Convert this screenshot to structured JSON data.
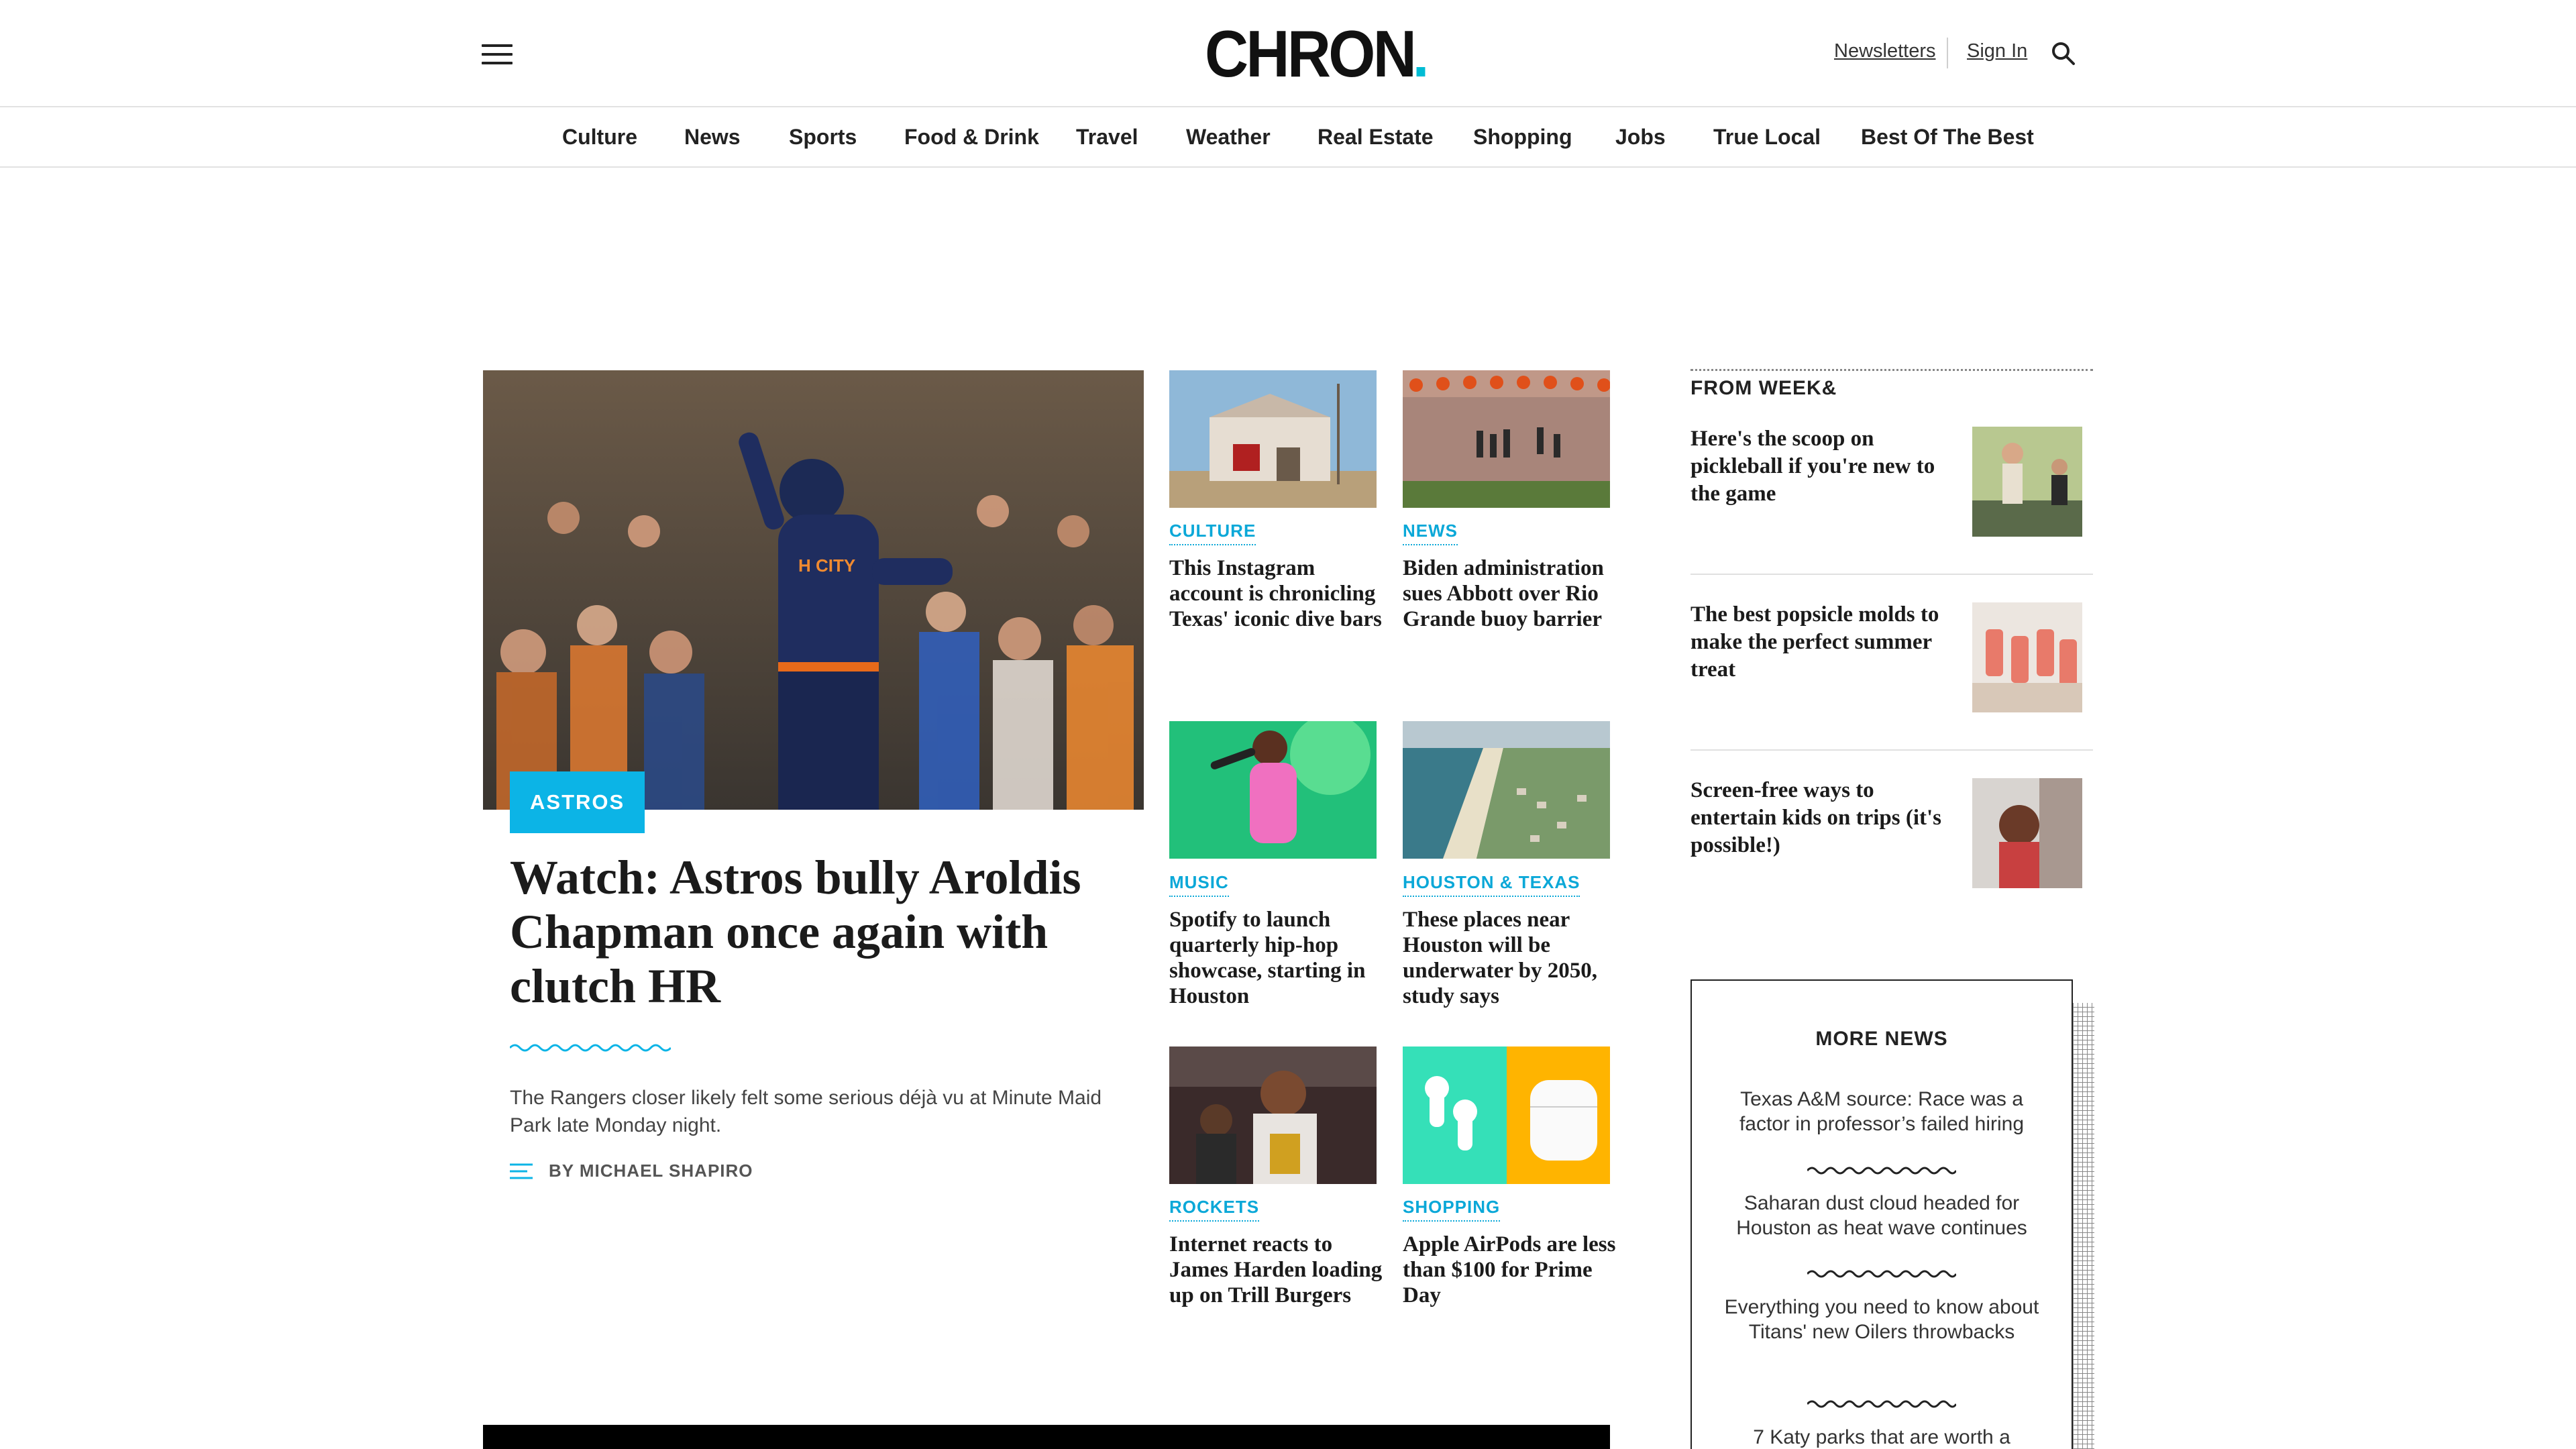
{
  "header": {
    "logo": "CHRON",
    "newsletters_label": "Newsletters",
    "signin_label": "Sign In"
  },
  "nav": {
    "items": [
      "Culture",
      "News",
      "Sports",
      "Food & Drink",
      "Travel",
      "Weather",
      "Real Estate",
      "Shopping",
      "Jobs",
      "True Local",
      "Best Of The Best"
    ]
  },
  "lead": {
    "category": "ASTROS",
    "title": "Watch: Astros bully Aroldis Chapman once again with clutch HR",
    "description": "The Rangers closer likely felt some serious déjà vu at Minute Maid Park late Monday night.",
    "byline": "BY MICHAEL SHAPIRO"
  },
  "grid": [
    {
      "category": "CULTURE",
      "title": "This Instagram account is chronicling Texas' iconic dive bars"
    },
    {
      "category": "NEWS",
      "title": "Biden administration sues Abbott over Rio Grande buoy barrier"
    },
    {
      "category": "MUSIC",
      "title": "Spotify to launch quarterly hip-hop showcase, starting in Houston"
    },
    {
      "category": "HOUSTON & TEXAS",
      "title": "These places near Houston will be underwater by 2050, study says"
    },
    {
      "category": "ROCKETS",
      "title": "Internet reacts to James Harden loading up on Trill Burgers"
    },
    {
      "category": "SHOPPING",
      "title": "Apple AirPods are less than $100 for Prime Day"
    }
  ],
  "rail": {
    "heading": "FROM WEEK&",
    "items": [
      {
        "title": "Here's the scoop on pickleball if you're new to the game"
      },
      {
        "title": "The best popsicle molds to make the perfect summer treat"
      },
      {
        "title": "Screen-free ways to entertain kids on trips (it's possible!)"
      }
    ]
  },
  "more_news": {
    "heading": "MORE NEWS",
    "items": [
      "Texas A&M source: Race was a factor in professor’s failed hiring",
      "Saharan dust cloud headed for Houston as heat wave continues",
      "Everything you need to know about Titans' new Oilers throwbacks",
      "7 Katy parks that are worth a"
    ]
  },
  "colors": {
    "accent": "#0cb4e6",
    "text": "#1b1b1b"
  }
}
